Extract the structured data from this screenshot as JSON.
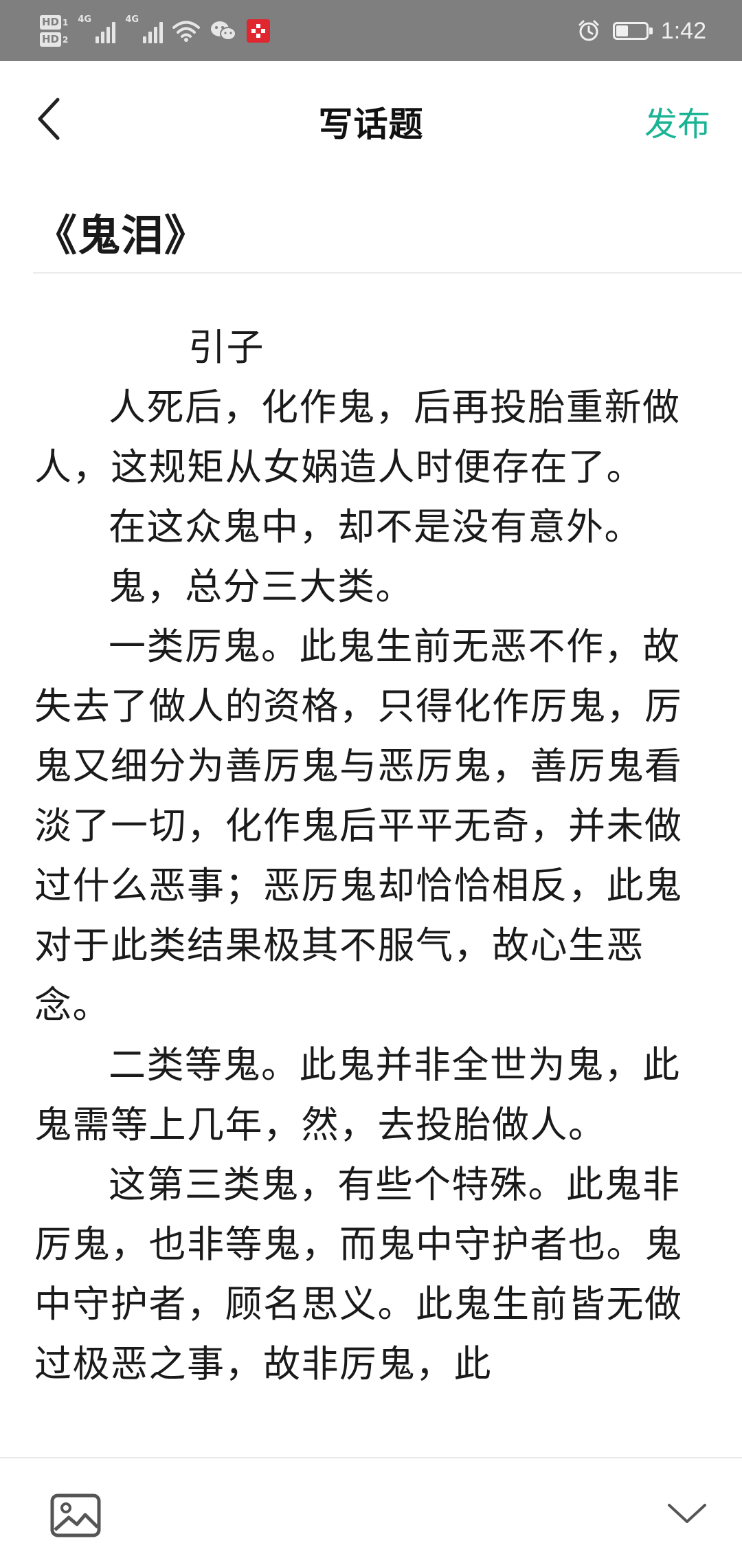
{
  "status_bar": {
    "time": "1:42",
    "hd1_label": "HD",
    "hd1_sub": "1",
    "hd2_label": "HD",
    "hd2_sub": "2",
    "network1": "4G",
    "network2": "4G",
    "battery_level": 0.4,
    "icons": [
      "hd-icon",
      "signal-icon",
      "wifi-icon",
      "wechat-icon",
      "red-app-icon",
      "alarm-icon",
      "battery-icon"
    ]
  },
  "nav": {
    "title": "写话题",
    "publish_label": "发布",
    "back_icon": "chevron-left-icon",
    "accent_color": "#1ab394"
  },
  "essay": {
    "title": "《鬼泪》",
    "heading": "引子",
    "paragraphs": [
      "人死后，化作鬼，后再投胎重新做人，这规矩从女娲造人时便存在了。",
      "在这众鬼中，却不是没有意外。",
      "鬼，总分三大类。",
      "一类厉鬼。此鬼生前无恶不作，故失去了做人的资格，只得化作厉鬼，厉鬼又细分为善厉鬼与恶厉鬼，善厉鬼看淡了一切，化作鬼后平平无奇，并未做过什么恶事；恶厉鬼却恰恰相反，此鬼对于此类结果极其不服气，故心生恶念。",
      "二类等鬼。此鬼并非全世为鬼，此鬼需等上几年，然，去投胎做人。",
      "这第三类鬼，有些个特殊。此鬼非厉鬼，也非等鬼，而鬼中守护者也。鬼中守护者，顾名思义。此鬼生前皆无做过极恶之事，故非厉鬼，此"
    ]
  },
  "toolbar": {
    "image_icon": "image-icon",
    "collapse_icon": "chevron-down-icon"
  }
}
